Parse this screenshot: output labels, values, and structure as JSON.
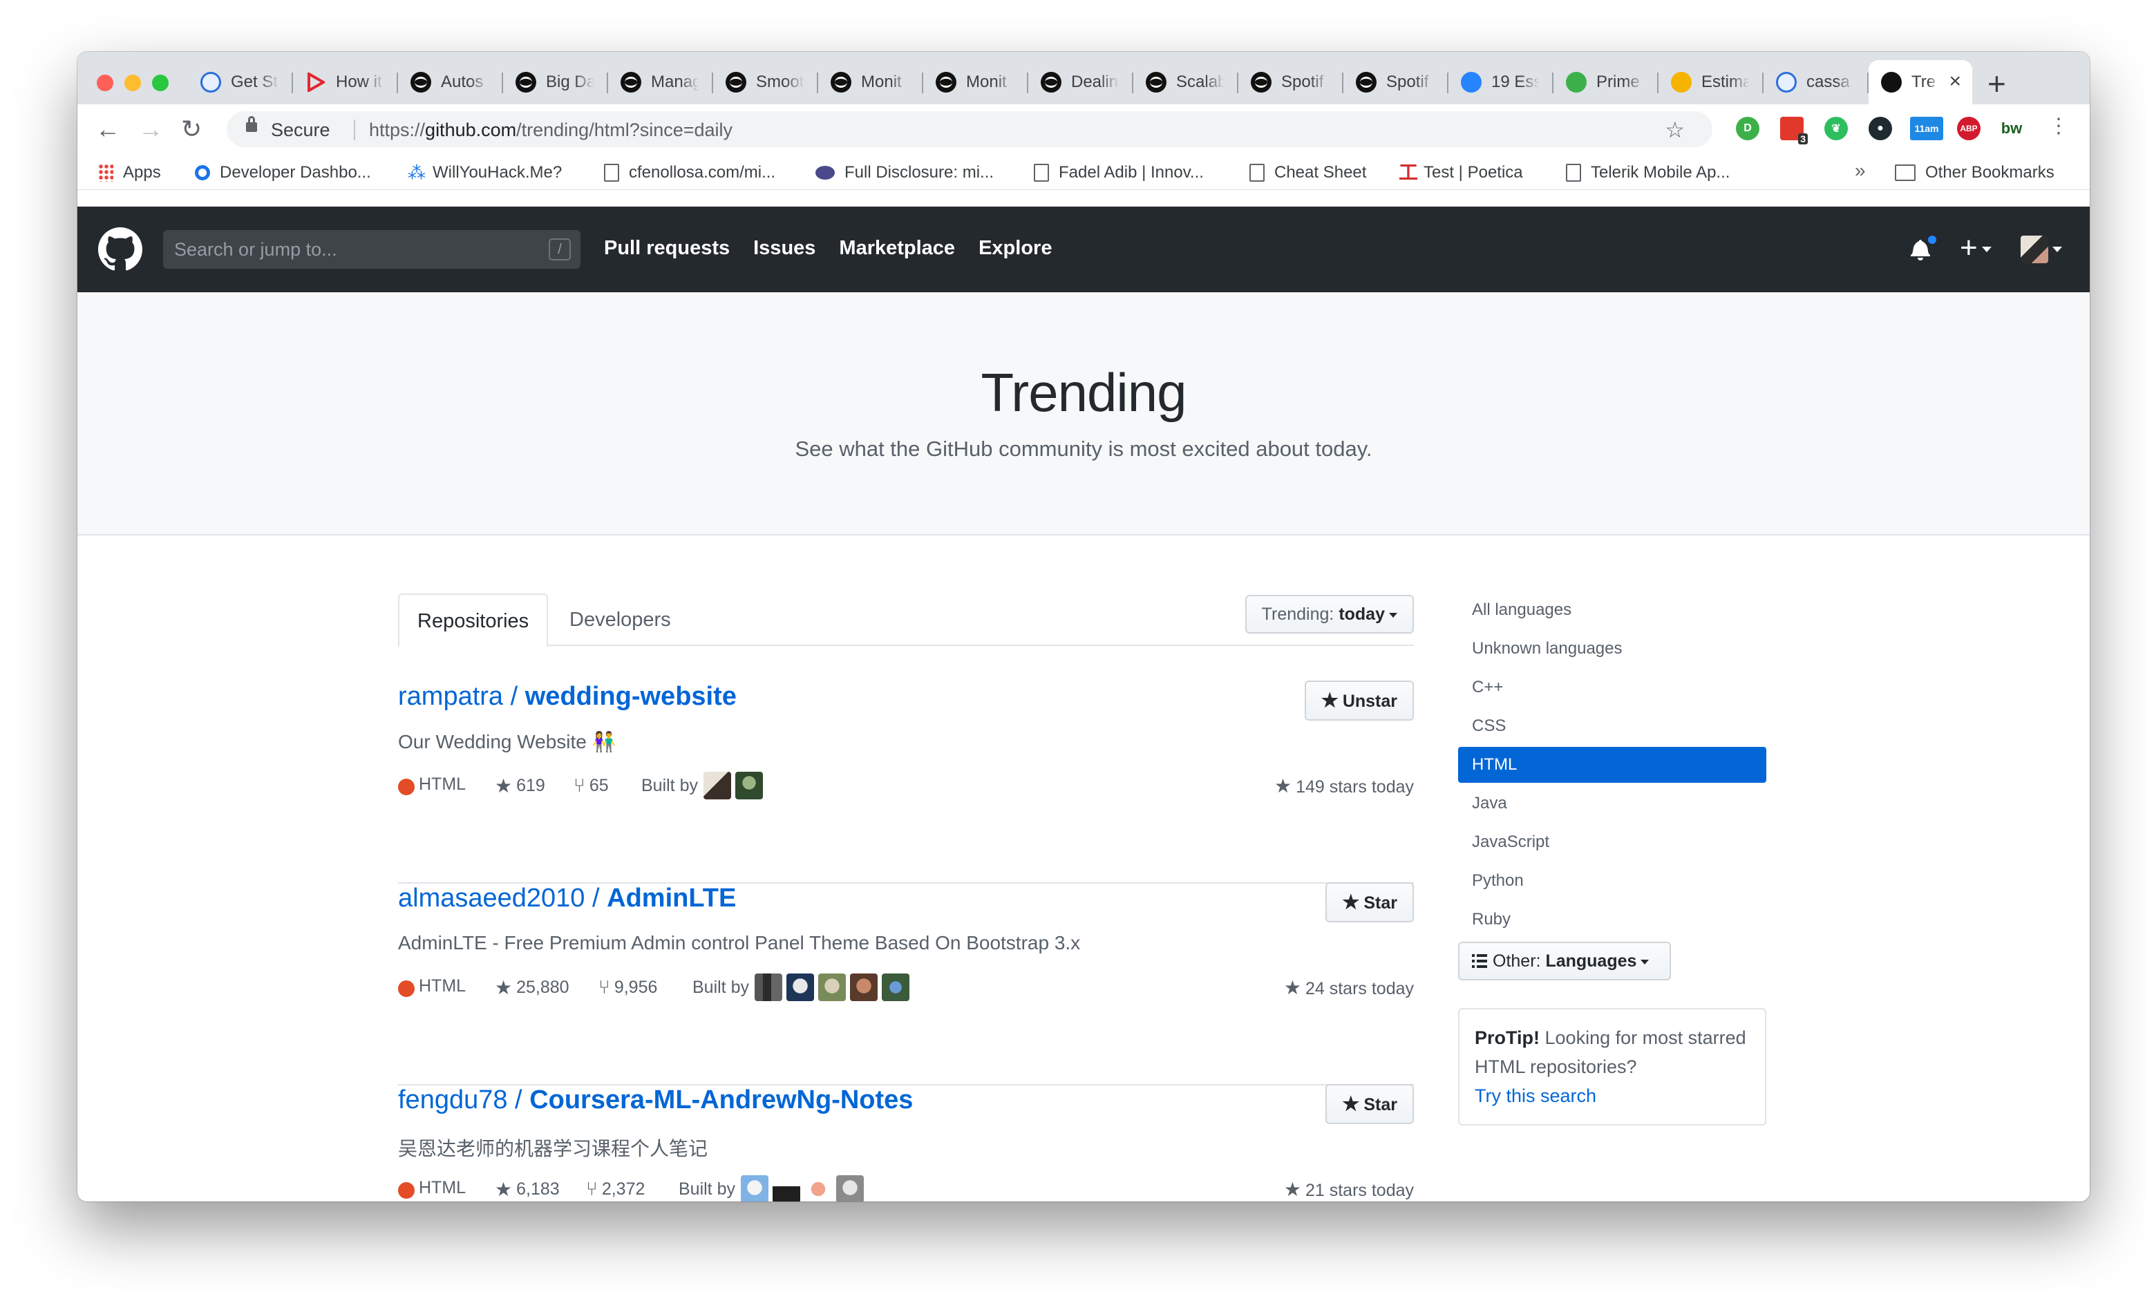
{
  "browser": {
    "tabs": [
      {
        "title": "Get St",
        "icon": "flutter-icon"
      },
      {
        "title": "How it",
        "icon": "youtube-icon"
      },
      {
        "title": "Autos",
        "icon": "spotify-icon"
      },
      {
        "title": "Big Da",
        "icon": "spotify-icon"
      },
      {
        "title": "Manag",
        "icon": "spotify-icon"
      },
      {
        "title": "Smoot",
        "icon": "spotify-icon"
      },
      {
        "title": "Monit",
        "icon": "spotify-icon"
      },
      {
        "title": "Monit",
        "icon": "spotify-icon"
      },
      {
        "title": "Dealin",
        "icon": "spotify-icon"
      },
      {
        "title": "Scalab",
        "icon": "spotify-icon"
      },
      {
        "title": "Spotif",
        "icon": "spotify-icon"
      },
      {
        "title": "Spotif",
        "icon": "spotify-icon"
      },
      {
        "title": "19 Ess",
        "icon": "jira-icon"
      },
      {
        "title": "Prime",
        "icon": "play-icon"
      },
      {
        "title": "Estima",
        "icon": "estimate-icon"
      },
      {
        "title": "cassa",
        "icon": "flutter-icon"
      }
    ],
    "active_tab": {
      "title": "Tre",
      "icon": "github-icon"
    },
    "secure_label": "Secure",
    "url_prefix": "https://",
    "url_host": "github.com",
    "url_path": "/trending/html?since=daily",
    "extension_badge": "3",
    "extension_time": "11am",
    "extension_abp": "ABP",
    "extension_bw": "bw",
    "bookmarks": [
      {
        "label": "Apps",
        "icon": "apps-grid-icon"
      },
      {
        "label": "Developer Dashbo...",
        "icon": "ring-icon"
      },
      {
        "label": "WillYouHack.Me?",
        "icon": "hack-icon"
      },
      {
        "label": "cfenollosa.com/mi...",
        "icon": "page-icon"
      },
      {
        "label": "Full Disclosure: mi...",
        "icon": "eye-icon"
      },
      {
        "label": "Fadel Adib | Innov...",
        "icon": "page-icon"
      },
      {
        "label": "Cheat Sheet",
        "icon": "page-icon"
      },
      {
        "label": "Test | Poetica",
        "icon": "poetica-icon"
      },
      {
        "label": "Telerik Mobile Ap...",
        "icon": "page-icon"
      }
    ],
    "bookmarks_more": "»",
    "other_bookmarks": "Other Bookmarks"
  },
  "github_header": {
    "search_placeholder": "Search or jump to...",
    "search_hotkey": "/",
    "nav": [
      "Pull requests",
      "Issues",
      "Marketplace",
      "Explore"
    ]
  },
  "hero": {
    "title": "Trending",
    "subtitle": "See what the GitHub community is most excited about today."
  },
  "subnav": {
    "tabs": [
      "Repositories",
      "Developers"
    ],
    "trending_label": "Trending:",
    "trending_value": "today"
  },
  "repos": [
    {
      "owner": "rampatra",
      "name": "wedding-website",
      "description": "Our Wedding Website 👫",
      "language": "HTML",
      "language_color": "#e34c26",
      "stars": "619",
      "forks": "65",
      "built_by_label": "Built by",
      "contributors": [
        "#3a2f28",
        "#2f4a2c"
      ],
      "stars_today": "149 stars today",
      "action": "Unstar"
    },
    {
      "owner": "almasaeed2010",
      "name": "AdminLTE",
      "description": "AdminLTE - Free Premium Admin control Panel Theme Based On Bootstrap 3.x",
      "language": "HTML",
      "language_color": "#e34c26",
      "stars": "25,880",
      "forks": "9,956",
      "built_by_label": "Built by",
      "contributors": [
        "#2b2b2b",
        "#1d3557",
        "#7a8b5a",
        "#5a3a2a",
        "#3b5b3b"
      ],
      "stars_today": "24 stars today",
      "action": "Star"
    },
    {
      "owner": "fengdu78",
      "name": "Coursera-ML-AndrewNg-Notes",
      "description": "吴恩达老师的机器学习课程个人笔记",
      "language": "HTML",
      "language_color": "#e34c26",
      "stars": "6,183",
      "forks": "2,372",
      "built_by_label": "Built by",
      "contributors": [
        "#7fb3e6",
        "#1f1f1f",
        "#f2a38c",
        "#8a8a8a"
      ],
      "stars_today": "21 stars today",
      "action": "Star"
    }
  ],
  "sidebar": {
    "languages": [
      "All languages",
      "Unknown languages",
      "C++",
      "CSS",
      "HTML",
      "Java",
      "JavaScript",
      "Python",
      "Ruby"
    ],
    "selected": "HTML",
    "other_label": "Other:",
    "other_value": "Languages",
    "protip_title": "ProTip!",
    "protip_text": "Looking for most starred HTML repositories?",
    "protip_link": "Try this search"
  },
  "colors": {
    "header_bg": "#24292e",
    "link": "#0366d6",
    "selected_lang_bg": "#0366d6",
    "html_lang": "#e34c26"
  }
}
